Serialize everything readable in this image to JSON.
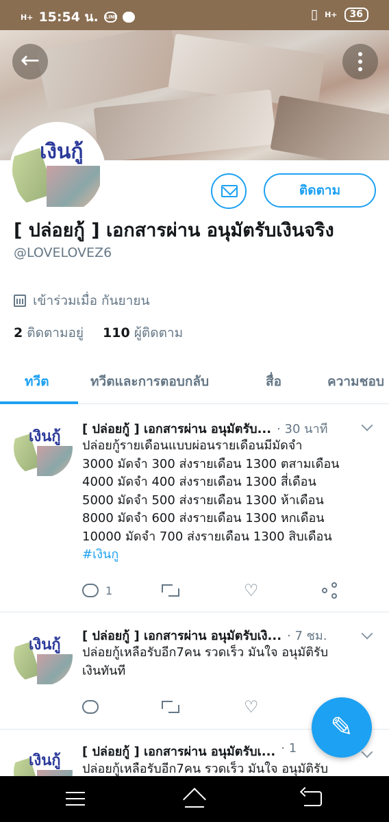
{
  "status_bar": {
    "time": "15:54 น.",
    "network_left": "H+",
    "network_right": "H+",
    "battery": "36"
  },
  "profile": {
    "avatar_text": "เงินกู้",
    "display_name": "[ ปล่อยกู้ ] เอกสารผ่าน อนุมัตรับเงินจริง",
    "handle": "@LOVELOVEZ6",
    "joined": "เข้าร่วมเมื่อ กันยายน",
    "following_count": "2",
    "following_label": "ติดตามอยู่",
    "followers_count": "110",
    "followers_label": "ผู้ติดตาม",
    "follow_button": "ติดตาม"
  },
  "tabs": [
    {
      "label": "ทวีต",
      "active": true
    },
    {
      "label": "ทวีตและการตอบกลับ",
      "active": false
    },
    {
      "label": "สื่อ",
      "active": false
    },
    {
      "label": "ความชอบ",
      "active": false
    }
  ],
  "tweets": [
    {
      "avatar_text": "เงินกู้",
      "name": "[ ปล่อยกู้ ] เอกสารผ่าน อนุมัตรับ...",
      "time": "· 30 นาที",
      "body": "ปล่อยกู้รายเดือนแบบผ่อนรายเดือนมีมัดจำ\n3000 มัดจำ 300 ส่งรายเดือน 1300 ตสามเดือน\n4000 มัดจำ 400 ส่งรายเดือน 1300 สี่เดือน\n5000 มัดจำ 500 ส่งรายเดือน 1300 ห้าเดือน\n8000 มัดจำ 600 ส่งรายเดือน 1300 หกเดือน\n10000 มัดจำ 700 ส่งรายเดือน 1300 สิบเดือน",
      "hashtag": "#เงินกู",
      "reply_count": "1"
    },
    {
      "avatar_text": "เงินกู้",
      "name": "[ ปล่อยกู้ ] เอกสารผ่าน อนุมัตรับเงิ...",
      "time": "· 7 ชม.",
      "body": "ปล่อยกู้เหลือรับอีก7คน รวดเร็ว  มันใจ   อนุมัติรับ\nเงินทันที",
      "hashtag": "",
      "reply_count": ""
    },
    {
      "avatar_text": "เงินกู้",
      "name": "[ ปล่อยกู้ ] เอกสารผ่าน อนุมัตรับเ...",
      "time": "· 1",
      "body": "ปล่อยกู้เหลือรับอีก7คน รวดเร็ว  มันใจ   อนุมัติรับ",
      "hashtag": "",
      "reply_count": ""
    }
  ],
  "icons": {
    "back": "arrow-left-icon",
    "more": "more-vertical-icon",
    "message": "envelope-icon",
    "calendar": "calendar-icon",
    "compose": "compose-feather-icon"
  },
  "colors": {
    "accent": "#1da1f2",
    "status_bar": "#8a6e52",
    "secondary_text": "#657786"
  }
}
